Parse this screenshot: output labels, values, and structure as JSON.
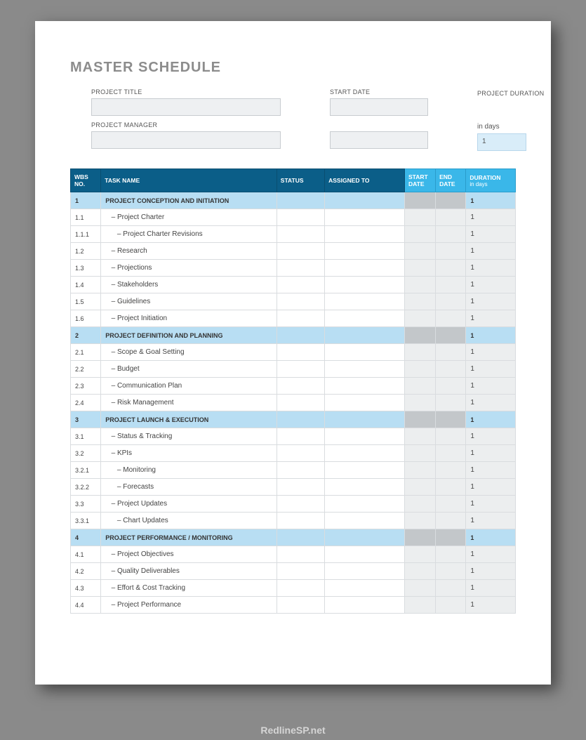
{
  "title": "MASTER SCHEDULE",
  "meta": {
    "project_title_label": "PROJECT TITLE",
    "project_manager_label": "PROJECT MANAGER",
    "start_date_label": "START DATE",
    "project_duration_label": "PROJECT DURATION",
    "duration_unit": "in days",
    "duration_value": "1"
  },
  "headers": {
    "wbs": "WBS NO.",
    "task": "TASK NAME",
    "status": "STATUS",
    "assigned": "ASSIGNED TO",
    "start": "START DATE",
    "end": "END DATE",
    "duration": "DURATION",
    "duration_sub": "in days"
  },
  "rows": [
    {
      "section": true,
      "wbs": "1",
      "task": "PROJECT CONCEPTION AND INITIATION",
      "duration": "1"
    },
    {
      "section": false,
      "wbs": "1.1",
      "task": "   – Project Charter",
      "duration": "1"
    },
    {
      "section": false,
      "wbs": "1.1.1",
      "task": "      – Project Charter Revisions",
      "duration": "1"
    },
    {
      "section": false,
      "wbs": "1.2",
      "task": "   – Research",
      "duration": "1"
    },
    {
      "section": false,
      "wbs": "1.3",
      "task": "   – Projections",
      "duration": "1"
    },
    {
      "section": false,
      "wbs": "1.4",
      "task": "   – Stakeholders",
      "duration": "1"
    },
    {
      "section": false,
      "wbs": "1.5",
      "task": "   – Guidelines",
      "duration": "1"
    },
    {
      "section": false,
      "wbs": "1.6",
      "task": "   – Project Initiation",
      "duration": "1"
    },
    {
      "section": true,
      "wbs": "2",
      "task": "PROJECT DEFINITION AND PLANNING",
      "duration": "1"
    },
    {
      "section": false,
      "wbs": "2.1",
      "task": "   – Scope & Goal Setting",
      "duration": "1"
    },
    {
      "section": false,
      "wbs": "2.2",
      "task": "   – Budget",
      "duration": "1"
    },
    {
      "section": false,
      "wbs": "2.3",
      "task": "   – Communication Plan",
      "duration": "1"
    },
    {
      "section": false,
      "wbs": "2.4",
      "task": "   – Risk Management",
      "duration": "1"
    },
    {
      "section": true,
      "wbs": "3",
      "task": "PROJECT LAUNCH & EXECUTION",
      "duration": "1"
    },
    {
      "section": false,
      "wbs": "3.1",
      "task": "   – Status & Tracking",
      "duration": "1"
    },
    {
      "section": false,
      "wbs": "3.2",
      "task": "   – KPIs",
      "duration": "1"
    },
    {
      "section": false,
      "wbs": "3.2.1",
      "task": "      – Monitoring",
      "duration": "1"
    },
    {
      "section": false,
      "wbs": "3.2.2",
      "task": "      – Forecasts",
      "duration": "1"
    },
    {
      "section": false,
      "wbs": "3.3",
      "task": "   – Project Updates",
      "duration": "1"
    },
    {
      "section": false,
      "wbs": "3.3.1",
      "task": "      – Chart Updates",
      "duration": "1"
    },
    {
      "section": true,
      "wbs": "4",
      "task": "PROJECT PERFORMANCE / MONITORING",
      "duration": "1"
    },
    {
      "section": false,
      "wbs": "4.1",
      "task": "   – Project Objectives",
      "duration": "1"
    },
    {
      "section": false,
      "wbs": "4.2",
      "task": "   – Quality Deliverables",
      "duration": "1"
    },
    {
      "section": false,
      "wbs": "4.3",
      "task": "   – Effort & Cost Tracking",
      "duration": "1"
    },
    {
      "section": false,
      "wbs": "4.4",
      "task": "   – Project Performance",
      "duration": "1"
    }
  ],
  "footer": "RedlineSP.net"
}
